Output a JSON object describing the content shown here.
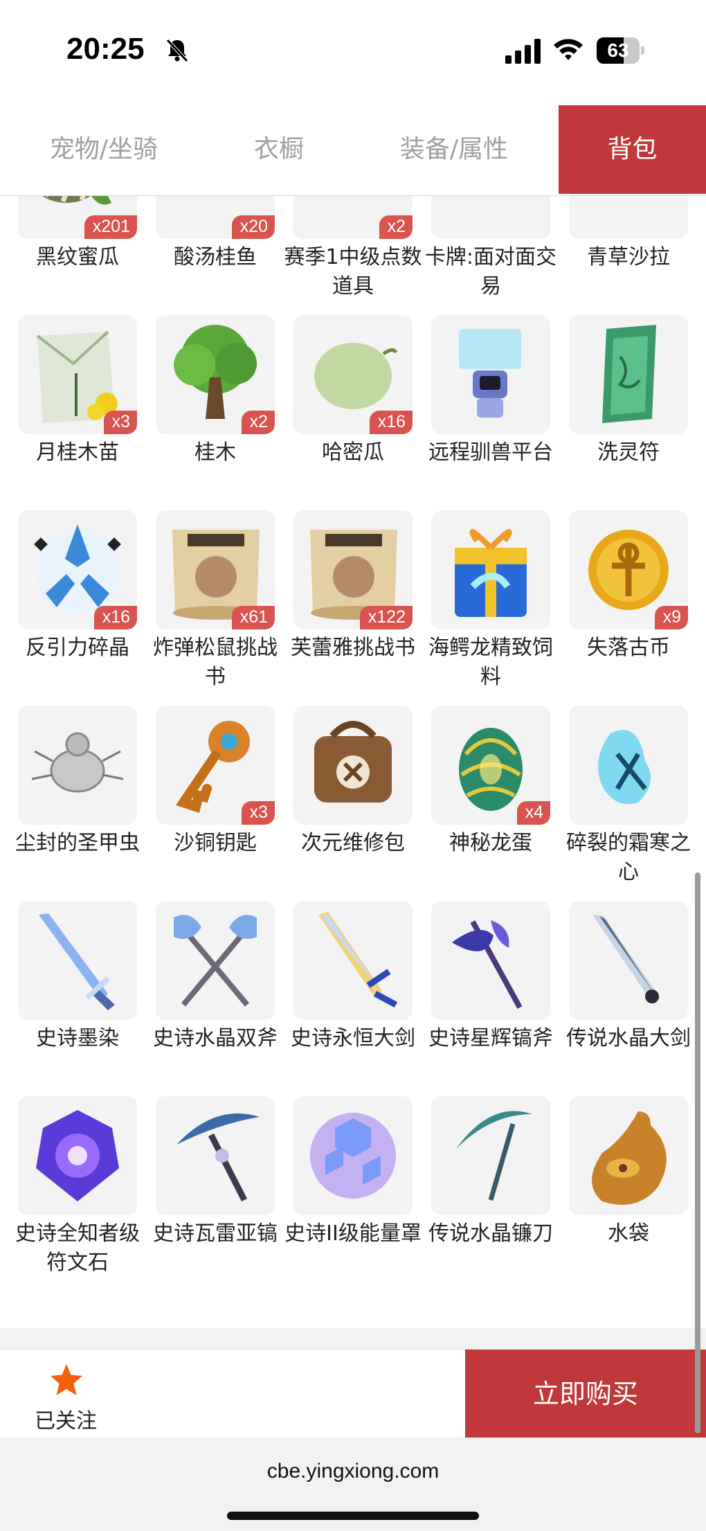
{
  "status_bar": {
    "time": "20:25",
    "battery": "63",
    "battery_level": 0.63
  },
  "tabs": [
    {
      "label": "宠物/坐骑",
      "active": false
    },
    {
      "label": "衣橱",
      "active": false
    },
    {
      "label": "装备/属性",
      "active": false
    },
    {
      "label": "背包",
      "active": true
    }
  ],
  "items": [
    {
      "name": "黑纹蜜瓜",
      "count": "x201",
      "icon": "striped-melon-icon"
    },
    {
      "name": "酸汤桂鱼",
      "count": "x20",
      "icon": "fish-soup-icon"
    },
    {
      "name": "赛季1中级点数道具",
      "count": "x2",
      "icon": "cake-icon"
    },
    {
      "name": "卡牌:面对面交易",
      "count": "",
      "icon": "trade-card-icon"
    },
    {
      "name": "青草沙拉",
      "count": "",
      "icon": "salad-icon"
    },
    {
      "name": "月桂木苗",
      "count": "x3",
      "icon": "seed-pack-icon"
    },
    {
      "name": "桂木",
      "count": "x2",
      "icon": "tree-icon"
    },
    {
      "name": "哈密瓜",
      "count": "x16",
      "icon": "melon-icon"
    },
    {
      "name": "远程驯兽平台",
      "count": "",
      "icon": "hologram-platform-icon"
    },
    {
      "name": "洗灵符",
      "count": "",
      "icon": "talisman-icon"
    },
    {
      "name": "反引力碎晶",
      "count": "x16",
      "icon": "crystal-shard-icon"
    },
    {
      "name": "炸弹松鼠挑战书",
      "count": "x61",
      "icon": "wanted-scroll-icon"
    },
    {
      "name": "芙蕾雅挑战书",
      "count": "x122",
      "icon": "wanted-scroll-icon"
    },
    {
      "name": "海鳄龙精致饲料",
      "count": "",
      "icon": "gift-box-icon"
    },
    {
      "name": "失落古币",
      "count": "x9",
      "icon": "gold-coin-icon"
    },
    {
      "name": "尘封的圣甲虫",
      "count": "",
      "icon": "beetle-icon"
    },
    {
      "name": "沙铜钥匙",
      "count": "x3",
      "icon": "key-icon"
    },
    {
      "name": "次元维修包",
      "count": "",
      "icon": "repair-bag-icon"
    },
    {
      "name": "神秘龙蛋",
      "count": "x4",
      "icon": "dragon-egg-icon"
    },
    {
      "name": "碎裂的霜寒之心",
      "count": "",
      "icon": "frost-heart-icon"
    },
    {
      "name": "史诗墨染",
      "count": "",
      "icon": "sword-icon"
    },
    {
      "name": "史诗水晶双斧",
      "count": "",
      "icon": "dual-axes-icon"
    },
    {
      "name": "史诗永恒大剑",
      "count": "",
      "icon": "greatsword-icon"
    },
    {
      "name": "史诗星辉镐斧",
      "count": "",
      "icon": "halberd-icon"
    },
    {
      "name": "传说水晶大剑",
      "count": "",
      "icon": "crystal-sword-icon"
    },
    {
      "name": "史诗全知者级符文石",
      "count": "",
      "icon": "rune-stone-icon"
    },
    {
      "name": "史诗瓦雷亚镐",
      "count": "",
      "icon": "pickaxe-icon"
    },
    {
      "name": "史诗II级能量罩",
      "count": "",
      "icon": "energy-shield-icon"
    },
    {
      "name": "传说水晶镰刀",
      "count": "",
      "icon": "scythe-icon"
    },
    {
      "name": "水袋",
      "count": "",
      "icon": "water-bag-icon"
    }
  ],
  "action_bar": {
    "follow_label": "已关注",
    "buy_label": "立即购买"
  },
  "browser": {
    "url": "cbe.yingxiong.com"
  },
  "colors": {
    "accent": "#c0383a",
    "badge": "#d9534f",
    "star": "#f2600f"
  }
}
